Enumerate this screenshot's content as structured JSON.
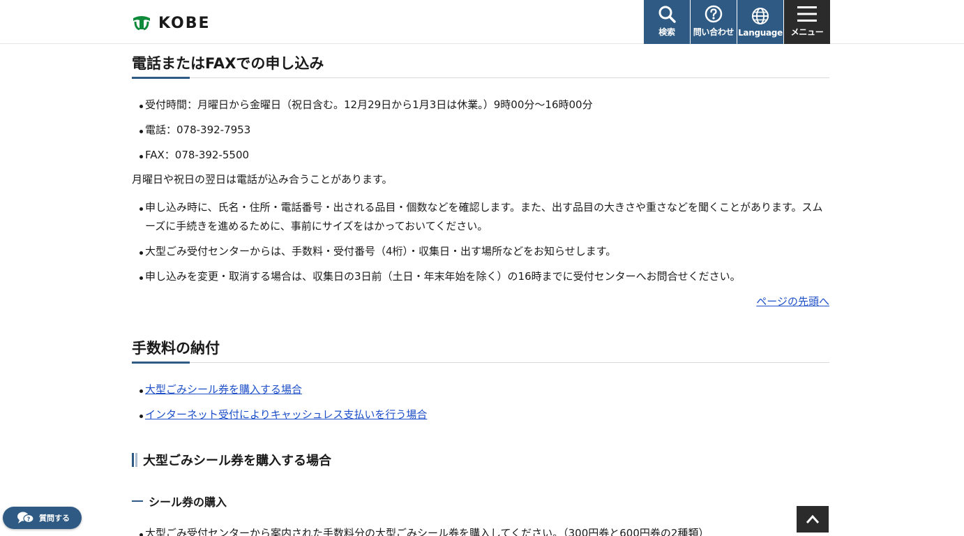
{
  "header": {
    "logo_text": "KOBE",
    "buttons": [
      {
        "label": "検索",
        "icon": "search-icon"
      },
      {
        "label": "問い合わせ",
        "icon": "question-icon"
      },
      {
        "label": "Language",
        "icon": "globe-icon"
      },
      {
        "label": "メニュー",
        "icon": "hamburger-icon"
      }
    ]
  },
  "section1": {
    "title": "電話またはFAXでの申し込み",
    "items": [
      "受付時間：月曜日から金曜日（祝日含む。12月29日から1月3日は休業。）9時00分〜16時00分",
      "電話：078-392-7953",
      "FAX：078-392-5500"
    ],
    "note": "月曜日や祝日の翌日は電話が込み合うことがあります。",
    "items2": [
      "申し込み時に、氏名・住所・電話番号・出される品目・個数などを確認します。また、出す品目の大きさや重さなどを聞くことがあります。スムーズに手続きを進めるために、事前にサイズをはかっておいてください。",
      "大型ごみ受付センターからは、手数料・受付番号（4桁）・収集日・出す場所などをお知らせします。",
      "申し込みを変更・取消する場合は、収集日の3日前（土日・年末年始を除く）の16時までに受付センターへお問合せください。"
    ],
    "to_top": "ページの先頭へ"
  },
  "section2": {
    "title": "手数料の納付",
    "links": [
      "大型ごみシール券を購入する場合",
      "インターネット受付によりキャッシュレス支払いを行う場合"
    ],
    "sub_heading": "大型ごみシール券を購入する場合",
    "sub_sub_heading": "シール券の購入",
    "partial_text": "大型ごみ受付センターから案内された手数料分の大型ごみシール券を購入してください。（300円券と600円券の2種類）"
  },
  "floating": {
    "chat_label": "質問する"
  },
  "colors": {
    "accent": "#2e5a84",
    "dark": "#2b2b2b",
    "link": "#1d4fc9"
  }
}
